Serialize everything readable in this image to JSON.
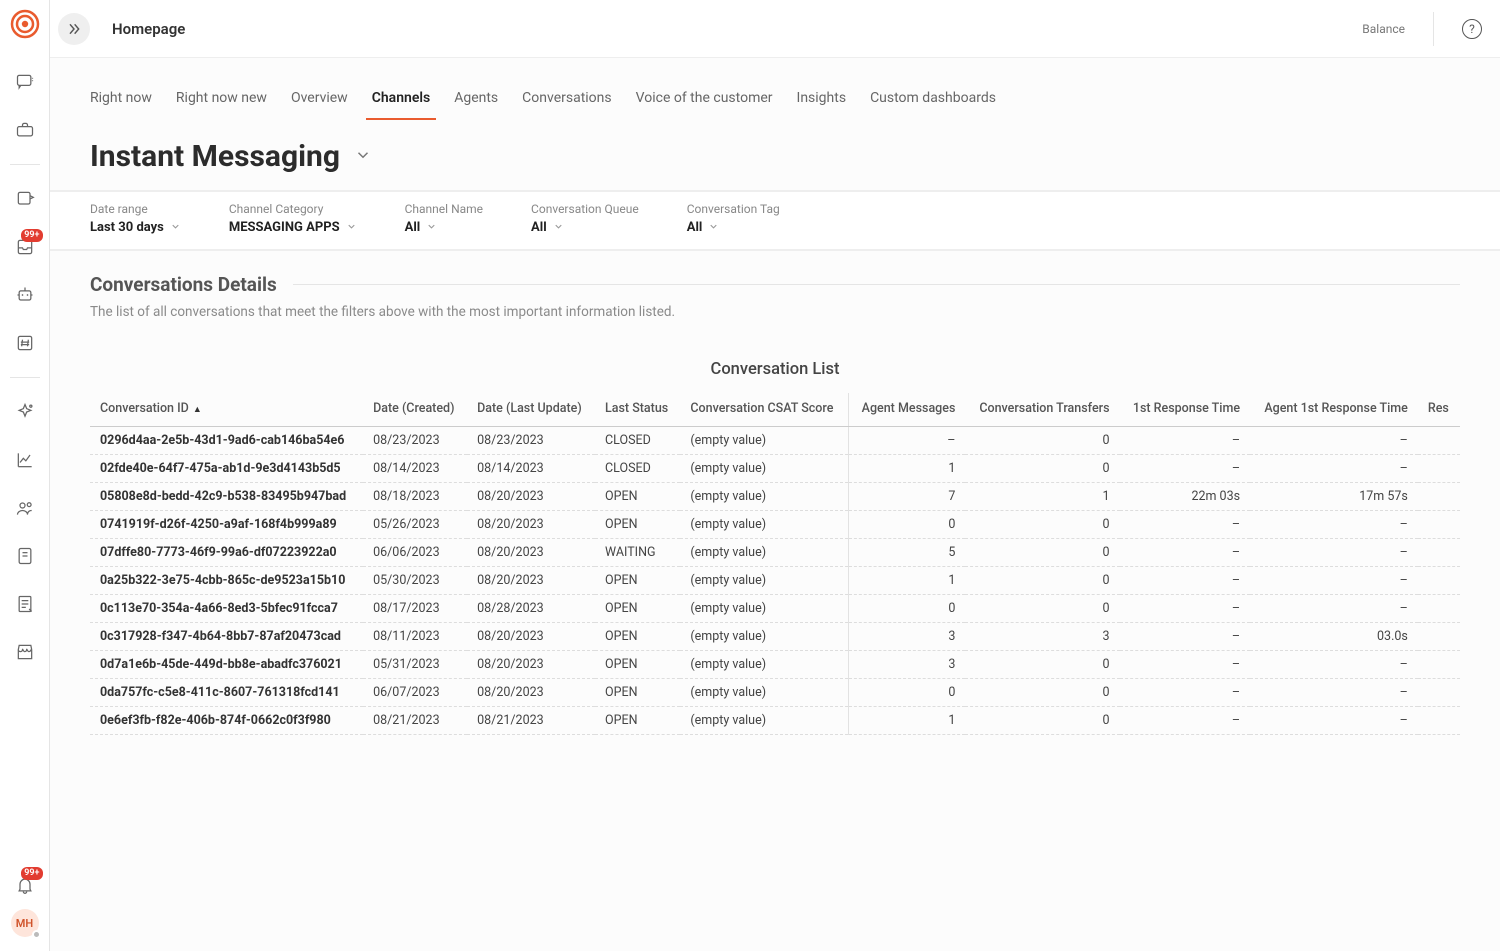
{
  "header": {
    "homepage": "Homepage",
    "balance": "Balance"
  },
  "sidebar": {
    "user_initials": "MH",
    "badge_inbox": "99+",
    "badge_bell": "99+"
  },
  "tabs": [
    {
      "label": "Right now",
      "active": false
    },
    {
      "label": "Right now new",
      "active": false
    },
    {
      "label": "Overview",
      "active": false
    },
    {
      "label": "Channels",
      "active": true
    },
    {
      "label": "Agents",
      "active": false
    },
    {
      "label": "Conversations",
      "active": false
    },
    {
      "label": "Voice of the customer",
      "active": false
    },
    {
      "label": "Insights",
      "active": false
    },
    {
      "label": "Custom dashboards",
      "active": false
    }
  ],
  "page_title": "Instant Messaging",
  "filters": [
    {
      "label": "Date range",
      "value": "Last 30 days"
    },
    {
      "label": "Channel Category",
      "value": "MESSAGING APPS"
    },
    {
      "label": "Channel Name",
      "value": "All"
    },
    {
      "label": "Conversation Queue",
      "value": "All"
    },
    {
      "label": "Conversation Tag",
      "value": "All"
    }
  ],
  "section": {
    "title": "Conversations Details",
    "desc": "The list of all conversations that meet the filters above with the most important information listed."
  },
  "table": {
    "title": "Conversation List",
    "columns": [
      "Conversation ID",
      "Date (Created)",
      "Date (Last Update)",
      "Last Status",
      "Conversation CSAT Score",
      "Agent Messages",
      "Conversation Transfers",
      "1st Response Time",
      "Agent 1st Response Time",
      "Res"
    ],
    "rows": [
      {
        "id": "0296d4aa-2e5b-43d1-9ad6-cab146ba54e6",
        "created": "08/23/2023",
        "updated": "08/23/2023",
        "status": "CLOSED",
        "csat": "(empty value)",
        "agent_msgs": "–",
        "transfers": "0",
        "first_rt": "–",
        "agent_first_rt": "–"
      },
      {
        "id": "02fde40e-64f7-475a-ab1d-9e3d4143b5d5",
        "created": "08/14/2023",
        "updated": "08/14/2023",
        "status": "CLOSED",
        "csat": "(empty value)",
        "agent_msgs": "1",
        "transfers": "0",
        "first_rt": "–",
        "agent_first_rt": "–"
      },
      {
        "id": "05808e8d-bedd-42c9-b538-83495b947bad",
        "created": "08/18/2023",
        "updated": "08/20/2023",
        "status": "OPEN",
        "csat": "(empty value)",
        "agent_msgs": "7",
        "transfers": "1",
        "first_rt": "22m 03s",
        "agent_first_rt": "17m 57s"
      },
      {
        "id": "0741919f-d26f-4250-a9af-168f4b999a89",
        "created": "05/26/2023",
        "updated": "08/20/2023",
        "status": "OPEN",
        "csat": "(empty value)",
        "agent_msgs": "0",
        "transfers": "0",
        "first_rt": "–",
        "agent_first_rt": "–"
      },
      {
        "id": "07dffe80-7773-46f9-99a6-df07223922a0",
        "created": "06/06/2023",
        "updated": "08/20/2023",
        "status": "WAITING",
        "csat": "(empty value)",
        "agent_msgs": "5",
        "transfers": "0",
        "first_rt": "–",
        "agent_first_rt": "–"
      },
      {
        "id": "0a25b322-3e75-4cbb-865c-de9523a15b10",
        "created": "05/30/2023",
        "updated": "08/20/2023",
        "status": "OPEN",
        "csat": "(empty value)",
        "agent_msgs": "1",
        "transfers": "0",
        "first_rt": "–",
        "agent_first_rt": "–"
      },
      {
        "id": "0c113e70-354a-4a66-8ed3-5bfec91fcca7",
        "created": "08/17/2023",
        "updated": "08/28/2023",
        "status": "OPEN",
        "csat": "(empty value)",
        "agent_msgs": "0",
        "transfers": "0",
        "first_rt": "–",
        "agent_first_rt": "–"
      },
      {
        "id": "0c317928-f347-4b64-8bb7-87af20473cad",
        "created": "08/11/2023",
        "updated": "08/20/2023",
        "status": "OPEN",
        "csat": "(empty value)",
        "agent_msgs": "3",
        "transfers": "3",
        "first_rt": "–",
        "agent_first_rt": "03.0s"
      },
      {
        "id": "0d7a1e6b-45de-449d-bb8e-abadfc376021",
        "created": "05/31/2023",
        "updated": "08/20/2023",
        "status": "OPEN",
        "csat": "(empty value)",
        "agent_msgs": "3",
        "transfers": "0",
        "first_rt": "–",
        "agent_first_rt": "–"
      },
      {
        "id": "0da757fc-c5e8-411c-8607-761318fcd141",
        "created": "06/07/2023",
        "updated": "08/20/2023",
        "status": "OPEN",
        "csat": "(empty value)",
        "agent_msgs": "0",
        "transfers": "0",
        "first_rt": "–",
        "agent_first_rt": "–"
      },
      {
        "id": "0e6ef3fb-f82e-406b-874f-0662c0f3f980",
        "created": "08/21/2023",
        "updated": "08/21/2023",
        "status": "OPEN",
        "csat": "(empty value)",
        "agent_msgs": "1",
        "transfers": "0",
        "first_rt": "–",
        "agent_first_rt": "–"
      }
    ]
  }
}
